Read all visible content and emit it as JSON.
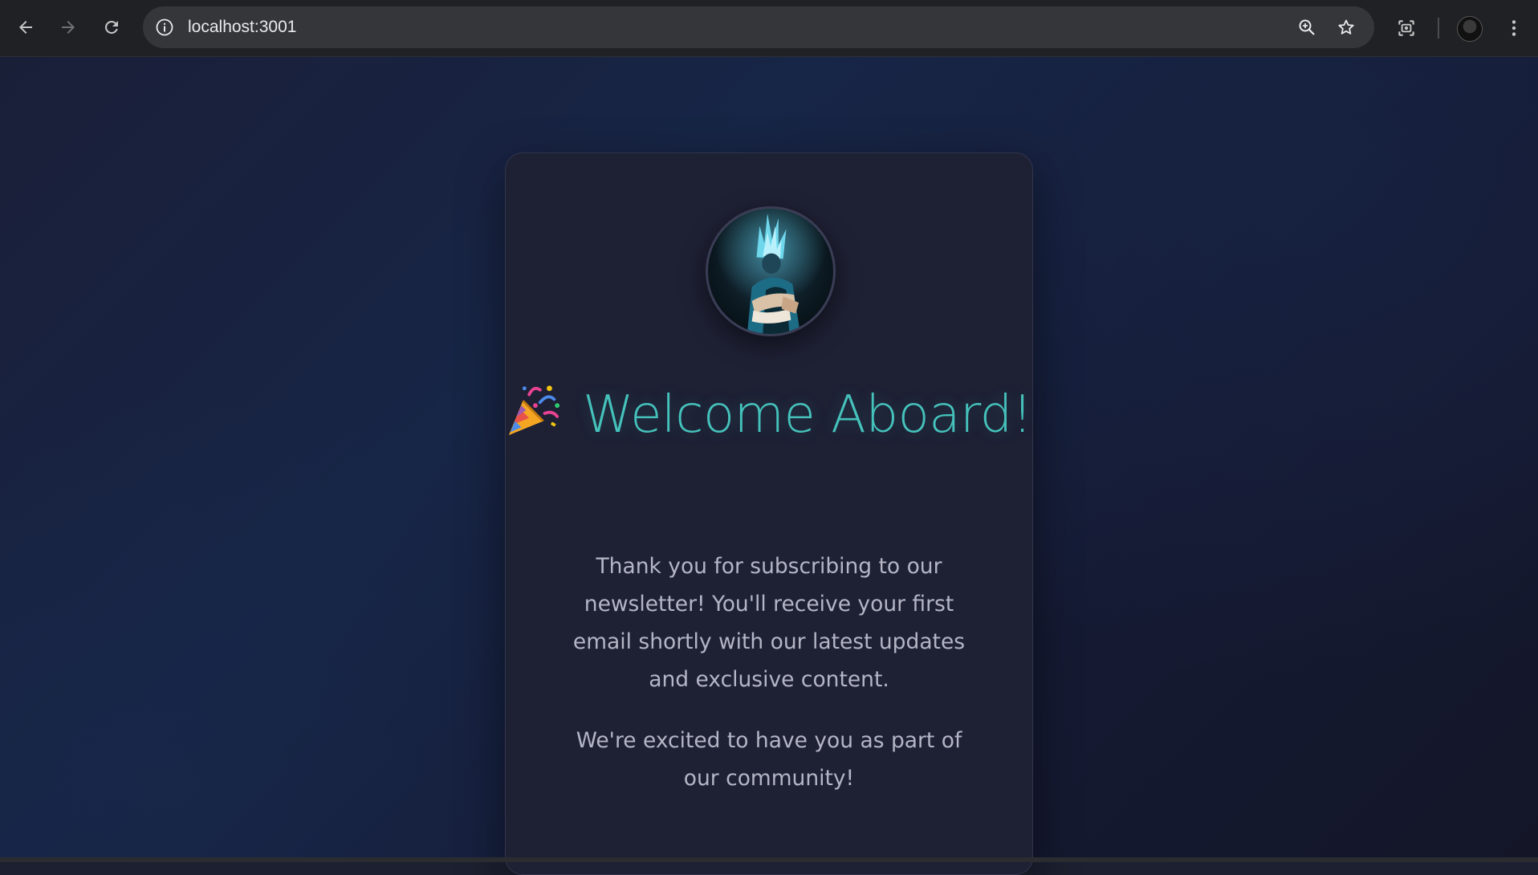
{
  "browser": {
    "url": "localhost:3001",
    "icons": {
      "back": "arrow-left-icon",
      "forward": "arrow-right-icon",
      "reload": "reload-icon",
      "site_info": "info-icon",
      "zoom": "zoom-in-icon",
      "bookmark": "star-icon",
      "screenshot": "screen-capture-icon",
      "profile": "profile-avatar",
      "menu": "kebab-menu-icon"
    }
  },
  "card": {
    "avatar_alt": "profile-avatar-image",
    "headline_emoji": "party-popper-icon",
    "headline": "Welcome Aboard!",
    "paragraph_1": "Thank you for subscribing to our newsletter! You'll receive your first email shortly with our latest updates and exclusive content.",
    "paragraph_2": "We're excited to have you as part of our community!"
  },
  "colors": {
    "accent": "#45c2bb",
    "card_background": "#1e2034",
    "body_text": "#b4b6c6",
    "page_background": "#172546"
  }
}
